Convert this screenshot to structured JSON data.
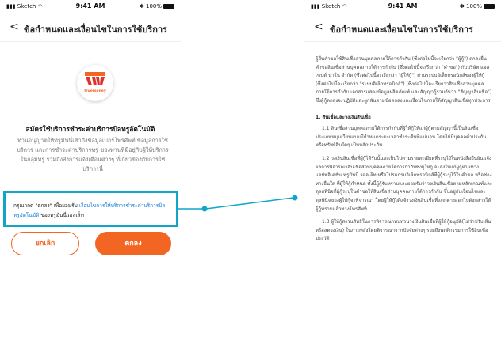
{
  "status_bar": {
    "carrier": "Sketch",
    "time": "9:41 AM",
    "battery": "100%"
  },
  "nav": {
    "back_symbol": "<",
    "title": "ข้อกำหนดและเงื่อนไขในการใช้บริการ"
  },
  "left": {
    "logo_text": "truemoney",
    "heading": "สมัครใช้บริการชำระค่าบริการบิลทรูอัตโนมัติ",
    "description": "ท่านอนุญาตให้ทรูมันนี่เข้าถึงข้อมูลเบอร์โทรศัพท์ ข้อมูลการใช้บริการ และการชำระค่าบริการทรู ของท่านที่มีอยู่กับผู้ให้บริการในกลุ่มทรู รวมถึงส่งการแจ้งเตือนต่างๆ ที่เกี่ยวข้องกับการใช้บริการนี้",
    "consent_prefix": "กรุณากด \"ตกลง\" เพื่อยอมรับ",
    "consent_link": "เงื่อนไขการให้บริการชำระค่าบริการบิลทรูอัตโนมัติ",
    "consent_suffix": "ของทรูมันนี่วอลเล็ท",
    "cancel_label": "ยกเลิก",
    "ok_label": "ตกลง"
  },
  "right": {
    "intro": "ผู้ยื่นคำขอใช้สินเชื่อส่วนบุคคลภายใต้การกำกับ (ซึ่งต่อไปนี้จะเรียกว่า \"ผู้กู้\") ตกลงยื่นคำขอสินเชื่อส่วนบุคคลภายใต้การกำกับ (ซึ่งต่อไปนี้จะเรียกว่า \"คำขอ\") กับบริษัท แอสเซนด์ นาโน จำกัด (ซึ่งต่อไปนี้จะเรียกว่า \"ผู้ให้กู้\") ผ่านระบบอิเล็กทรอนิกส์ของผู้ให้กู้ (ซึ่งต่อไปนี้จะเรียกว่า \"ระบบอิเล็กทรอนิกส์\") (ซึ่งต่อไปนี้จะเรียกว่าสินเชื่อส่วนบุคคล ภายใต้การกำกับ เอกสารแสดงข้อมูลผลิตภัณฑ์ และสัญญากู้รวมกันว่า \"สัญญาสินเชื่อ\") ซึ่งผู้กู้ตกลงจะปฏิบัติและผูกพันตามข้อตกลงและเงื่อนไขภายใต้สัญญาสินเชื่อทุกประการ",
    "section1": "1. สินเชื่อและวงเงินสินเชื่อ",
    "p11": "1.1 สินเชื่อส่วนบุคคลภายใต้การกำกับที่ผู้ให้กู้ให้แก่ผู้กู้ตามสัญญานี้เป็นสินเชื่อประเภทหมุนเวียนแบบมีกำหนดระยะเวลาชำระคืนที่แน่นอน โดยไม่มีบุคคลค้ำประกันหรือทรัพย์สินใดๆ เป็นหลักประกัน",
    "p12": "1.2 วงเงินสินเชื่อที่ผู้กู้ได้รับนั้นจะเป็นไปตามรายละเอียดที่ระบุไว้ในหนังสือยืนยันแจ้งผลการพิจารณาสินเชื่อส่วนบุคคลภายใต้การกำกับซึ่งผู้ให้กู้ จะส่งให้แก่ผู้กู้ผ่านทางแอปพลิเคชัน ทรูมันนี่ วอลเล็ท หรือโปรแกรมอิเล็กทรอนิกส์ที่ผู้กู้ระบุไว้ในคำขอ หรือช่องทางอื่นใด ที่ผู้ให้กู้กำหนด ทั้งนี้ผู้กู้รับทราบและยอมรับว่าวงเงินสินเชื่อตามหลักเกณฑ์และดุลยพินิจที่ผู้กู้ระบุในคำขอให้สินเชื่อส่วนบุคคลภายใต้การกำกับ ขึ้นอยู่กับเงื่อนไขและดุลพินิจของผู้ให้กู้จะพิจารณา โดยผู้ให้กู้ได้แจ้งวงเงินสินเชื่อที่แตกต่างออกไปดังกล่าวให้ผู้กู้ทราบแล้วทางโทรศัพท์",
    "p13": "1.3 ผู้ให้กู้สงวนสิทธิในการพิจารณาทบทวนวงเงินสินเชื่อที่ผู้ให้กู้อนุมัติ(ไม่ว่าปรับเพิ่ม หรือลดวงเงิน) ในภายหลังโดยพิจารณาจากปัจจัยต่างๆ รวมถึงพฤติกรรมการใช้สินเชื่อ ประวัติ"
  },
  "colors": {
    "accent": "#f26522",
    "highlight": "#11a6c7",
    "link": "#1a7fd6"
  }
}
